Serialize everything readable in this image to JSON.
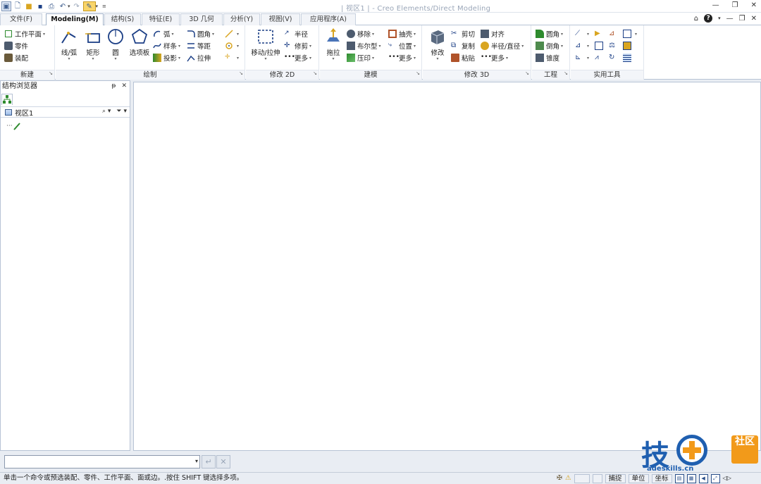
{
  "window": {
    "title": "| 视区1 | - Creo Elements/Direct Modeling",
    "controls": [
      "minimize",
      "restore",
      "close"
    ]
  },
  "tabs": [
    {
      "label": "文件(F)"
    },
    {
      "label": "Modeling(M)",
      "active": true
    },
    {
      "label": "结构(S)"
    },
    {
      "label": "特征(E)"
    },
    {
      "label": "3D 几何"
    },
    {
      "label": "分析(Y)"
    },
    {
      "label": "视图(V)"
    },
    {
      "label": "应用程序(A)"
    }
  ],
  "ribbon": {
    "new": {
      "label": "新建",
      "items": [
        "工作平面",
        "零件",
        "装配"
      ]
    },
    "draw": {
      "label": "绘制",
      "big": [
        "线/弧",
        "矩形",
        "圆",
        "选项板"
      ],
      "small": [
        "弧",
        "样条",
        "投影",
        "圆角",
        "等距",
        "拉伸"
      ]
    },
    "modify2d": {
      "label": "修改 2D",
      "big": "移动/拉伸",
      "small": [
        "半径",
        "修剪",
        "更多"
      ]
    },
    "model": {
      "label": "建模",
      "big": "拖拉",
      "small": [
        "移除",
        "布尔型",
        "压印",
        "抽壳",
        "位置",
        "更多"
      ]
    },
    "modify3d": {
      "label": "修改 3D",
      "big": "修改",
      "small": [
        "剪切",
        "复制",
        "粘贴",
        "对齐",
        "半径/直径",
        "更多"
      ]
    },
    "engineering": {
      "label": "工程",
      "small": [
        "圆角",
        "倒角",
        "锥度"
      ]
    },
    "utilities": {
      "label": "实用工具"
    }
  },
  "browser": {
    "title": "结构浏览器",
    "root": "视区1"
  },
  "command": {
    "value": ""
  },
  "status": {
    "message": "单击一个命令或预选装配、零件、工作平面、面或边。.按住 SHIFT 键选择多项。",
    "snap": "捕捉",
    "units": "单位",
    "extra": "坐标"
  },
  "watermark": {
    "text": "技",
    "tag": "社区",
    "url": "adeskills.cn"
  },
  "colors": {
    "accent": "#1c3f86",
    "ribbon_bg": "#ffffff",
    "frame": "#e9edf3",
    "watermark_blue": "#1f5fb0",
    "watermark_orange": "#f29a1a"
  }
}
